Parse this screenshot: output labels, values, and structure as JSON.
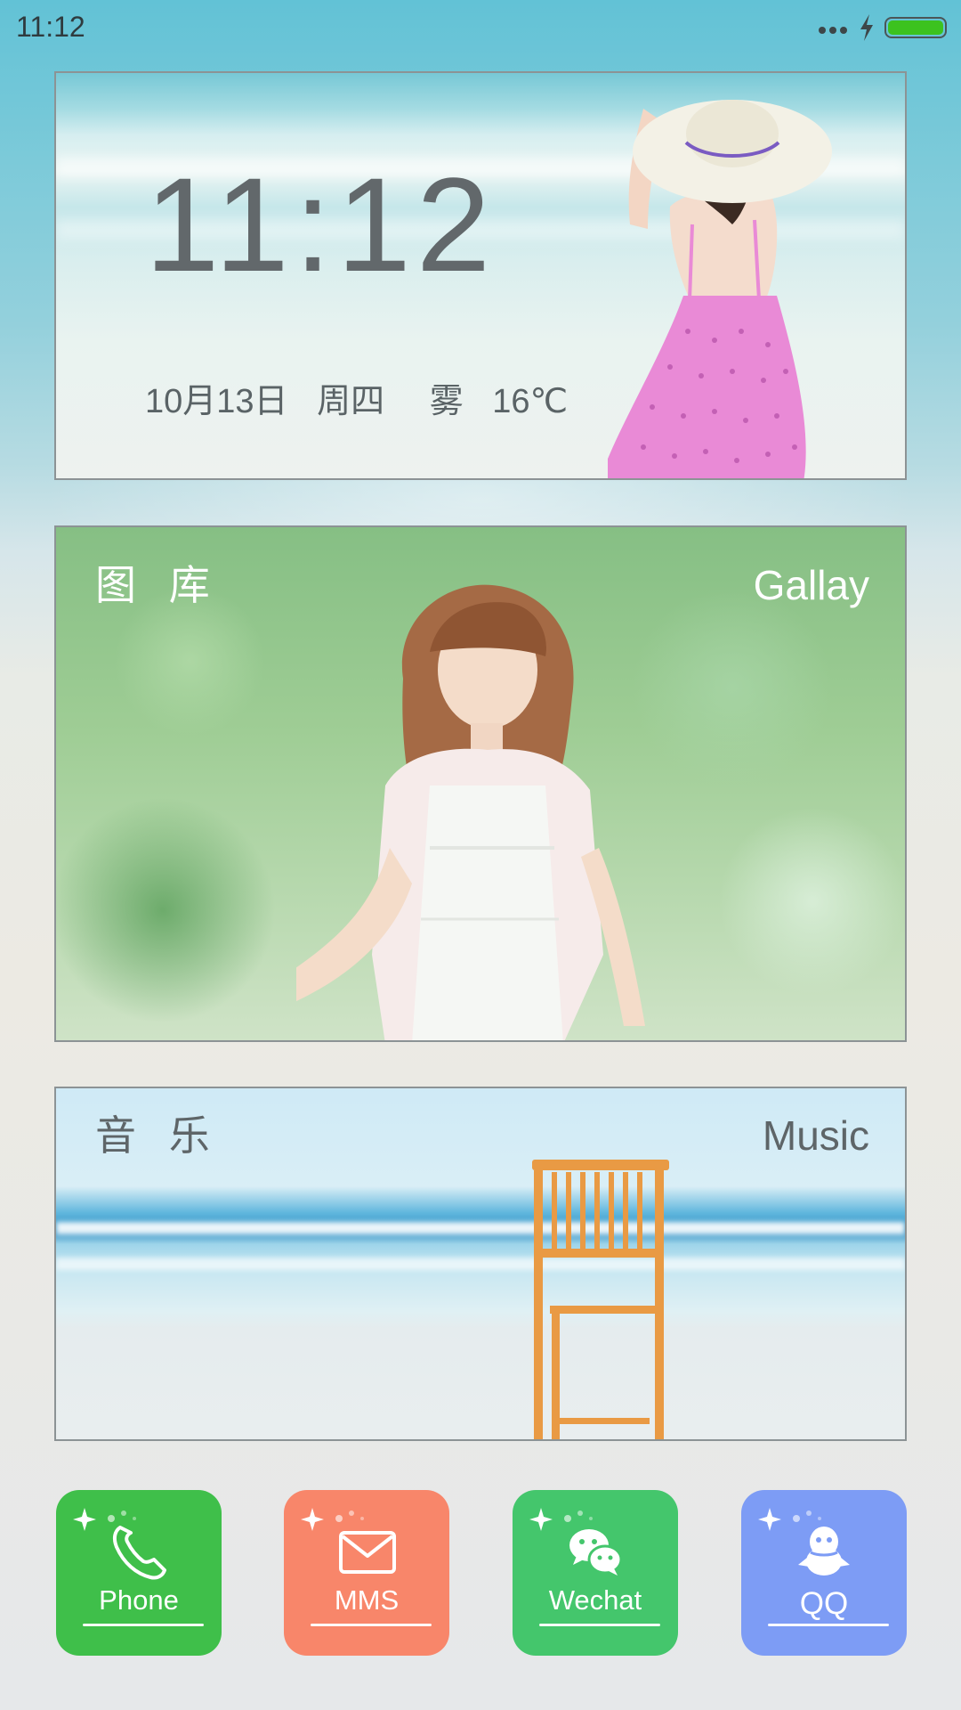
{
  "status_bar": {
    "time": "11:12",
    "icons": [
      "more-dots-icon",
      "charging-icon",
      "battery-icon"
    ],
    "battery_level": 1.0,
    "battery_color": "#3cc21f"
  },
  "clock_widget": {
    "time": "11:12",
    "date": "10月13日",
    "weekday": "周四",
    "weather": "雾",
    "temperature": "16℃"
  },
  "gallery_widget": {
    "title_cn": "图 库",
    "title_en": "Gallay"
  },
  "music_widget": {
    "title_cn": "音 乐",
    "title_en": "Music"
  },
  "dock": {
    "apps": [
      {
        "label": "Phone",
        "icon": "phone-icon",
        "color": "#3fbf4a"
      },
      {
        "label": "MMS",
        "icon": "envelope-icon",
        "color": "#f8866a"
      },
      {
        "label": "Wechat",
        "icon": "wechat-icon",
        "color": "#44c66c"
      },
      {
        "label": "QQ",
        "icon": "qq-penguin-icon",
        "color": "#7d9cf5"
      }
    ]
  }
}
